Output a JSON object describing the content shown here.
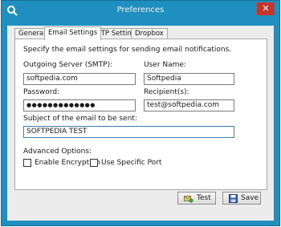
{
  "window": {
    "title": "Preferences",
    "close_glyph": "✕"
  },
  "tabs": [
    {
      "label": "General"
    },
    {
      "label": "Email Settings"
    },
    {
      "label": "FTP Settings"
    },
    {
      "label": "Dropbox"
    }
  ],
  "panel": {
    "intro": "Specify the email settings for sending email notifications.",
    "smtp_label": "Outgoing Server (SMTP):",
    "smtp_value": "softpedia.com",
    "user_label": "User Name:",
    "user_value": "Softpedia",
    "password_label": "Password:",
    "password_value": "●●●●●●●●●●●●●",
    "recipients_label": "Recipient(s):",
    "recipients_value": "test@softpedia.com",
    "subject_label": "Subject of the email to be sent:",
    "subject_value": "SOFTPEDIA TEST",
    "advanced_label": "Advanced Options:",
    "encryption_label": "Enable Encryption",
    "port_label": "Use Specific Port"
  },
  "buttons": {
    "test_label": "Test",
    "save_label": "Save"
  },
  "colors": {
    "titlebar": "#1e8fbf",
    "close": "#c7362b"
  }
}
